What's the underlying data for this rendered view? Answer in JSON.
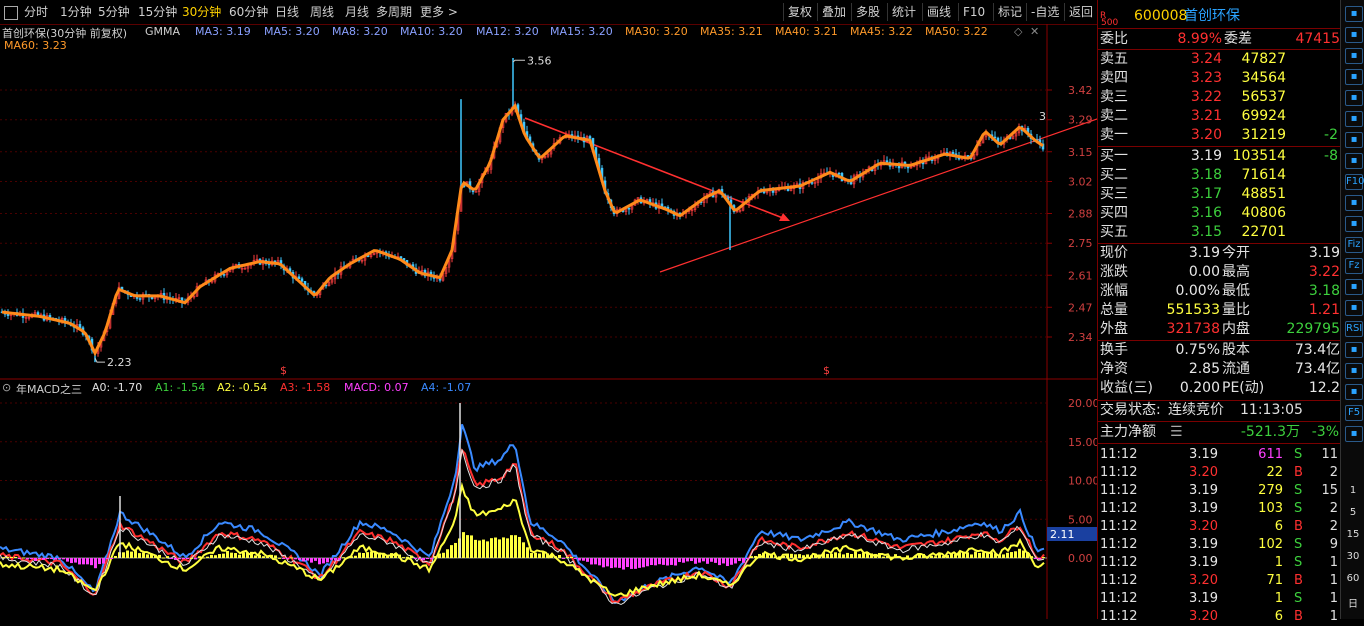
{
  "toolbar": {
    "periods": [
      "分时",
      "1分钟",
      "5分钟",
      "15分钟",
      "30分钟",
      "60分钟",
      "日线",
      "周线",
      "月线",
      "多周期",
      "更多 >"
    ],
    "active_period": "30分钟",
    "right_buttons": [
      "复权",
      "叠加",
      "多股",
      "统计",
      "画线",
      "F10",
      "标记",
      "-自选",
      "返回"
    ]
  },
  "ma_legend": {
    "stock": "首创环保(30分钟 前复权)",
    "indicator": "GMMA",
    "items": [
      {
        "label": "MA3: 3.19",
        "color": "#8aa0ff"
      },
      {
        "label": "MA5: 3.20",
        "color": "#8aa0ff"
      },
      {
        "label": "MA8: 3.20",
        "color": "#8aa0ff"
      },
      {
        "label": "MA10: 3.20",
        "color": "#8aa0ff"
      },
      {
        "label": "MA12: 3.20",
        "color": "#8aa0ff"
      },
      {
        "label": "MA15: 3.20",
        "color": "#8aa0ff"
      },
      {
        "label": "MA30: 3.20",
        "color": "#ff9a2a"
      },
      {
        "label": "MA35: 3.21",
        "color": "#ff9a2a"
      },
      {
        "label": "MA40: 3.21",
        "color": "#ff9a2a"
      },
      {
        "label": "MA45: 3.22",
        "color": "#ff9a2a"
      },
      {
        "label": "MA50: 3.22",
        "color": "#ff9a2a"
      }
    ],
    "ma60": "MA60: 3.23"
  },
  "price_axis": [
    "3.42",
    "3.29",
    "3.15",
    "3.02",
    "2.88",
    "2.75",
    "2.61",
    "2.47",
    "2.34"
  ],
  "price_annotations": {
    "high": "3.56",
    "low": "2.23",
    "marker": "3"
  },
  "macd_legend": {
    "name": "年MACD之三",
    "items": [
      {
        "label": "A0: -1.70",
        "color": "#e0e0e0"
      },
      {
        "label": "A1: -1.54",
        "color": "#3dd03d"
      },
      {
        "label": "A2: -0.54",
        "color": "#ffff40"
      },
      {
        "label": "A3: -1.58",
        "color": "#ff3030"
      },
      {
        "label": "MACD: 0.07",
        "color": "#ff40ff"
      },
      {
        "label": "A4: -1.07",
        "color": "#3a8aff"
      }
    ]
  },
  "macd_axis": [
    "20.00",
    "15.00",
    "10.00",
    "5.00",
    "0.00"
  ],
  "macd_current": "2.11",
  "quote": {
    "code_prefix": "R\n500",
    "code": "600008",
    "name": "首创环保",
    "webi_label": "委比",
    "webi_value": "8.99%",
    "weicha_label": "委差",
    "weicha_value": "47415",
    "asks": [
      {
        "label": "卖五",
        "price": "3.24",
        "vol": "47827",
        "chg": ""
      },
      {
        "label": "卖四",
        "price": "3.23",
        "vol": "34564",
        "chg": ""
      },
      {
        "label": "卖三",
        "price": "3.22",
        "vol": "56537",
        "chg": ""
      },
      {
        "label": "卖二",
        "price": "3.21",
        "vol": "69924",
        "chg": ""
      },
      {
        "label": "卖一",
        "price": "3.20",
        "vol": "31219",
        "chg": "-2"
      }
    ],
    "bids": [
      {
        "label": "买一",
        "price": "3.19",
        "vol": "103514",
        "chg": "-8"
      },
      {
        "label": "买二",
        "price": "3.18",
        "vol": "71614",
        "chg": ""
      },
      {
        "label": "买三",
        "price": "3.17",
        "vol": "48851",
        "chg": ""
      },
      {
        "label": "买四",
        "price": "3.16",
        "vol": "40806",
        "chg": ""
      },
      {
        "label": "买五",
        "price": "3.15",
        "vol": "22701",
        "chg": ""
      }
    ],
    "stats": [
      {
        "l1": "现价",
        "v1": "3.19",
        "c1": "#e8e8e8",
        "l2": "今开",
        "v2": "3.19",
        "c2": "#e8e8e8"
      },
      {
        "l1": "涨跌",
        "v1": "0.00",
        "c1": "#e8e8e8",
        "l2": "最高",
        "v2": "3.22",
        "c2": "#ff3030"
      },
      {
        "l1": "涨幅",
        "v1": "0.00%",
        "c1": "#e8e8e8",
        "l2": "最低",
        "v2": "3.18",
        "c2": "#3dd03d"
      },
      {
        "l1": "总量",
        "v1": "551533",
        "c1": "#ffff40",
        "l2": "量比",
        "v2": "1.21",
        "c2": "#ff3030"
      },
      {
        "l1": "外盘",
        "v1": "321738",
        "c1": "#ff3030",
        "l2": "内盘",
        "v2": "229795",
        "c2": "#3dd03d"
      }
    ],
    "stats2": [
      {
        "l1": "换手",
        "v1": "0.75%",
        "l2": "股本",
        "v2": "73.4亿"
      },
      {
        "l1": "净资",
        "v1": "2.85",
        "l2": "流通",
        "v2": "73.4亿"
      },
      {
        "l1": "收益(三)",
        "v1": "0.200",
        "l2": "PE(动)",
        "v2": "12.2"
      }
    ],
    "trade_state_label": "交易状态:",
    "trade_state": "连续竞价",
    "trade_time": "11:13:05",
    "zl_label": "主力净额",
    "zl_value": "-521.3万",
    "zl_pct": "-3%",
    "ticks": [
      {
        "t": "11:12",
        "p": "3.19",
        "pc": "#e8e8e8",
        "v": "611",
        "vc": "#ff40ff",
        "s": "S",
        "n": "11"
      },
      {
        "t": "11:12",
        "p": "3.20",
        "pc": "#ff3030",
        "v": "22",
        "vc": "#ffff40",
        "s": "B",
        "n": "2"
      },
      {
        "t": "11:12",
        "p": "3.19",
        "pc": "#e8e8e8",
        "v": "279",
        "vc": "#ffff40",
        "s": "S",
        "n": "15"
      },
      {
        "t": "11:12",
        "p": "3.19",
        "pc": "#e8e8e8",
        "v": "103",
        "vc": "#ffff40",
        "s": "S",
        "n": "2"
      },
      {
        "t": "11:12",
        "p": "3.20",
        "pc": "#ff3030",
        "v": "6",
        "vc": "#ffff40",
        "s": "B",
        "n": "2"
      },
      {
        "t": "11:12",
        "p": "3.19",
        "pc": "#e8e8e8",
        "v": "102",
        "vc": "#ffff40",
        "s": "S",
        "n": "9"
      },
      {
        "t": "11:12",
        "p": "3.19",
        "pc": "#e8e8e8",
        "v": "1",
        "vc": "#ffff40",
        "s": "S",
        "n": "1"
      },
      {
        "t": "11:12",
        "p": "3.20",
        "pc": "#ff3030",
        "v": "71",
        "vc": "#ffff40",
        "s": "B",
        "n": "1"
      },
      {
        "t": "11:12",
        "p": "3.19",
        "pc": "#e8e8e8",
        "v": "1",
        "vc": "#ffff40",
        "s": "S",
        "n": "1"
      },
      {
        "t": "11:12",
        "p": "3.20",
        "pc": "#ff3030",
        "v": "6",
        "vc": "#ffff40",
        "s": "B",
        "n": "1"
      }
    ]
  },
  "right_tools": {
    "icons": [
      "window-icon",
      "up-arrow-icon",
      "down-arrow-icon",
      "grid-icon",
      "table-icon",
      "list-icon",
      "candle-icon",
      "window2-icon",
      "f10-icon",
      "chart-icon",
      "doc-icon",
      "fiz-icon",
      "fz-icon",
      "circle-icon",
      "macd-icon",
      "rsi-icon",
      "arrow-up-icon",
      "move-icon",
      "pen-icon",
      "f5-icon",
      "grid2-icon"
    ],
    "icon_labels": {
      "f10-icon": "F10",
      "fiz-icon": "Fiz",
      "fz-icon": "Fz",
      "rsi-icon": "RSI",
      "f5-icon": "F5"
    },
    "numbers": [
      "1",
      "5",
      "15",
      "30",
      "60",
      "日"
    ]
  }
}
